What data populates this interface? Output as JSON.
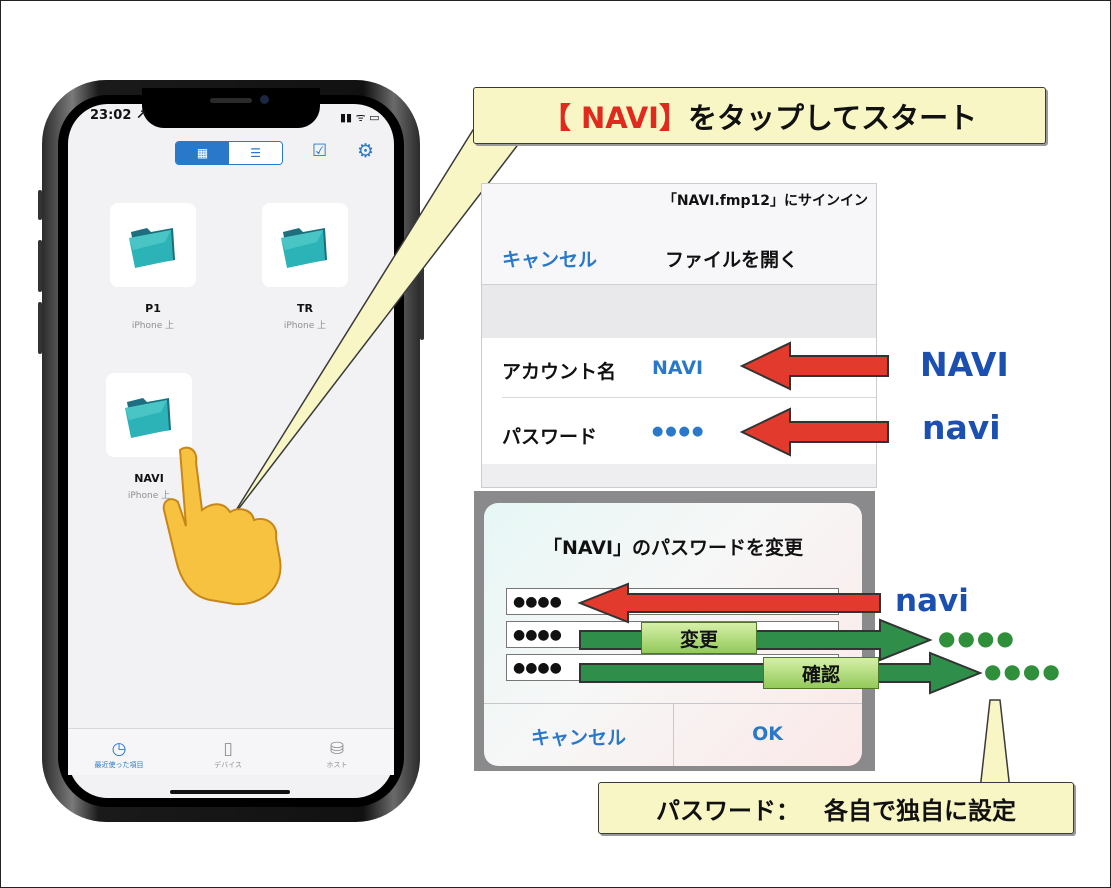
{
  "phone": {
    "time": "23:02 ↗",
    "status_icons": "▮▮ ᯤ ▭",
    "view_modes": [
      "▦",
      "☰"
    ],
    "files": [
      {
        "name": "P1",
        "location": "iPhone 上"
      },
      {
        "name": "TR",
        "location": "iPhone 上"
      },
      {
        "name": "NAVI",
        "location": "iPhone 上"
      }
    ],
    "tabs": [
      {
        "label": "最近使った項目",
        "icon": "clock-icon"
      },
      {
        "label": "デバイス",
        "icon": "device-icon"
      },
      {
        "label": "ホスト",
        "icon": "database-icon"
      }
    ]
  },
  "callout": {
    "highlight": "【 NAVI】",
    "text": "をタップしてスタート"
  },
  "signin": {
    "title": "「NAVI.fmp12」にサインイン",
    "cancel": "キャンセル",
    "open": "ファイルを開く",
    "account_label": "アカウント名",
    "account_value": "NAVI",
    "password_label": "パスワード",
    "password_value": "●●●●",
    "account_hint": "NAVI",
    "password_hint": "navi"
  },
  "change_dialog": {
    "title": "「NAVI」のパスワードを変更",
    "fields": [
      "●●●●",
      "●●●●",
      "●●●●"
    ],
    "old_hint": "navi",
    "change_tag": "変更",
    "confirm_tag": "確認",
    "new_dots": "●●●●",
    "confirm_dots": "●●●●",
    "cancel": "キャンセル",
    "ok": "OK"
  },
  "note": {
    "label": "パスワード：",
    "text": "各自で独自に設定"
  },
  "colors": {
    "ios_blue": "#2a78c9",
    "callout_red": "#e02a1e",
    "hint_blue": "#1b4fb0",
    "arrow_red": "#e23b2e",
    "arrow_green": "#2f8f4a",
    "callout_bg": "#f8f6c4"
  }
}
